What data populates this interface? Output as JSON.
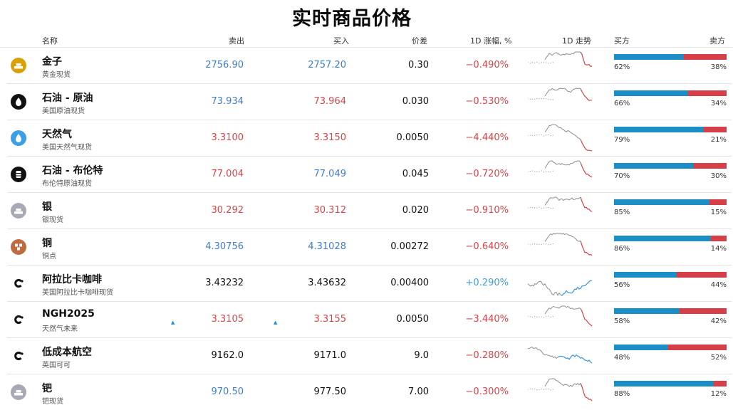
{
  "title": "实时商品价格",
  "columns": {
    "name": "名称",
    "sell": "卖出",
    "buy": "买入",
    "spread": "价差",
    "change": "1D 涨幅, %",
    "trend": "1D 走势",
    "buyer": "买方",
    "seller": "卖方"
  },
  "colors": {
    "buy_bar": "#1b8ec7",
    "sell_bar": "#d63f48",
    "up": "#3f7ec9",
    "down": "#d9434b"
  },
  "rows": [
    {
      "name": "金子",
      "sub": "黄金现货",
      "icon": "gold-bars-icon",
      "sell": "2756.90",
      "sell_color": "blue",
      "buy": "2757.20",
      "buy_color": "blue",
      "spread": "0.30",
      "change": "−0.490%",
      "change_color": "red",
      "buyer_pct": 62,
      "buyer": "62%",
      "seller": "38%",
      "spark": "down"
    },
    {
      "name": "石油 - 原油",
      "sub": "美国原油现货",
      "icon": "oil-drop-icon",
      "sell": "73.934",
      "sell_color": "blue",
      "buy": "73.964",
      "buy_color": "red",
      "spread": "0.030",
      "change": "−0.530%",
      "change_color": "red",
      "buyer_pct": 66,
      "buyer": "66%",
      "seller": "34%",
      "spark": "down"
    },
    {
      "name": "天然气",
      "sub": "美国天然气现货",
      "icon": "gas-flame-icon",
      "sell": "3.3100",
      "sell_color": "red",
      "buy": "3.3150",
      "buy_color": "red",
      "spread": "0.0050",
      "change": "−4.440%",
      "change_color": "red",
      "buyer_pct": 79,
      "buyer": "79%",
      "seller": "21%",
      "spark": "down"
    },
    {
      "name": "石油 - 布伦特",
      "sub": "布伦特原油现货",
      "icon": "oil-barrel-icon",
      "sell": "77.004",
      "sell_color": "red",
      "buy": "77.049",
      "buy_color": "blue",
      "spread": "0.045",
      "change": "−0.720%",
      "change_color": "red",
      "buyer_pct": 70,
      "buyer": "70%",
      "seller": "30%",
      "spark": "down"
    },
    {
      "name": "银",
      "sub": "银现货",
      "icon": "silver-bars-icon",
      "sell": "30.292",
      "sell_color": "red",
      "buy": "30.312",
      "buy_color": "red",
      "spread": "0.020",
      "change": "−0.910%",
      "change_color": "red",
      "buyer_pct": 85,
      "buyer": "85%",
      "seller": "15%",
      "spark": "down"
    },
    {
      "name": "铜",
      "sub": "铜点",
      "icon": "copper-icon",
      "sell": "4.30756",
      "sell_color": "blue",
      "buy": "4.31028",
      "buy_color": "blue",
      "spread": "0.00272",
      "change": "−0.640%",
      "change_color": "red",
      "buyer_pct": 86,
      "buyer": "86%",
      "seller": "14%",
      "spark": "down"
    },
    {
      "name": "阿拉比卡咖啡",
      "sub": "美国阿拉比卡咖啡现货",
      "icon": "coffee-c-icon",
      "sell": "3.43232",
      "sell_color": "dark",
      "buy": "3.43632",
      "buy_color": "dark",
      "spread": "0.00400",
      "change": "+0.290%",
      "change_color": "green-pos",
      "buyer_pct": 56,
      "buyer": "56%",
      "seller": "44%",
      "spark": "up"
    },
    {
      "name": "NGH2025",
      "sub": "天然气未来",
      "icon": "futures-c-icon",
      "sell": "3.3105",
      "sell_color": "red",
      "buy": "3.3155",
      "buy_color": "red",
      "spread": "0.0050",
      "change": "−3.440%",
      "change_color": "red",
      "buyer_pct": 58,
      "buyer": "58%",
      "seller": "42%",
      "spark": "down",
      "ticks": true
    },
    {
      "name": "低成本航空",
      "sub": "英国可可",
      "icon": "cocoa-c-icon",
      "sell": "9162.0",
      "sell_color": "dark",
      "buy": "9171.0",
      "buy_color": "dark",
      "spread": "9.0",
      "change": "−0.280%",
      "change_color": "red",
      "buyer_pct": 48,
      "buyer": "48%",
      "seller": "52%",
      "spark": "mixed"
    },
    {
      "name": "钯",
      "sub": "钯现货",
      "icon": "palladium-bars-icon",
      "sell": "970.50",
      "sell_color": "blue",
      "buy": "977.50",
      "buy_color": "dark",
      "spread": "7.00",
      "change": "−0.300%",
      "change_color": "red",
      "buyer_pct": 88,
      "buyer": "88%",
      "seller": "12%",
      "spark": "down"
    }
  ]
}
